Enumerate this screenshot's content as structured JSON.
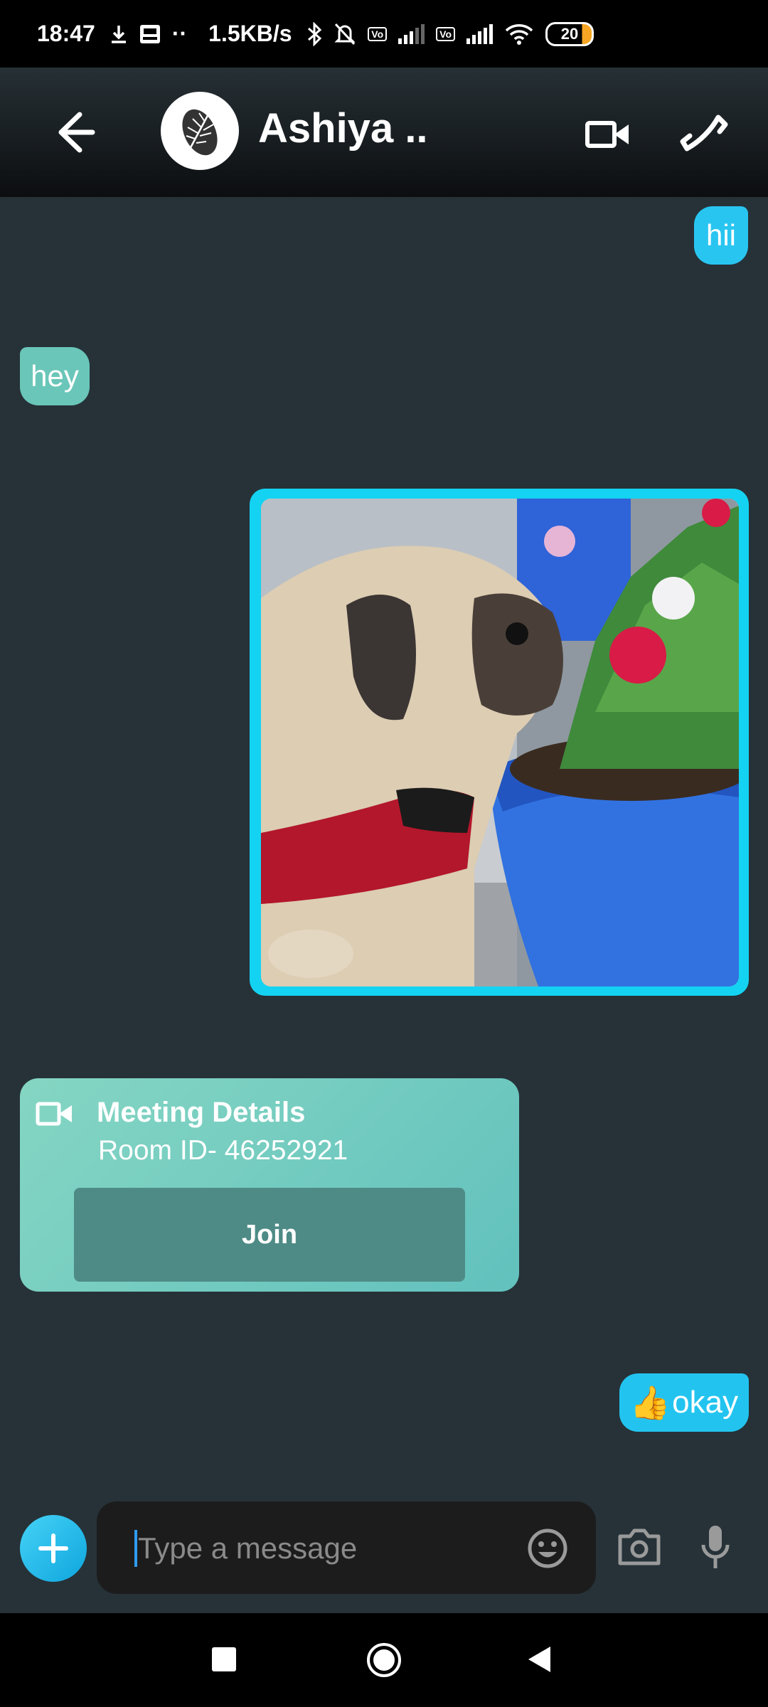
{
  "status_bar": {
    "time": "18:47",
    "net_speed": "1.5KB/s",
    "battery": "20",
    "volte_label": "Vo LTE"
  },
  "header": {
    "contact_name": "Ashiya ..",
    "icons": [
      "back-arrow-icon",
      "video-camera-icon",
      "phone-icon"
    ]
  },
  "messages": {
    "sent_1": "hii",
    "received_1": "hey",
    "sent_image_alt": "pug sniffing flowers in blue pot",
    "meeting": {
      "title": "Meeting Details",
      "room": "Room ID- 46252921",
      "join_label": "Join"
    },
    "sent_2_emoji": "👍",
    "sent_2_text": "okay"
  },
  "composer": {
    "placeholder": "Type a message",
    "icons": [
      "plus-icon",
      "emoji-icon",
      "camera-icon",
      "mic-icon"
    ]
  },
  "colors": {
    "background": "#263238",
    "sent_bubble": "#29c5f1",
    "received_bubble": "#6ac6b9",
    "join_button": "#4f8b86"
  }
}
